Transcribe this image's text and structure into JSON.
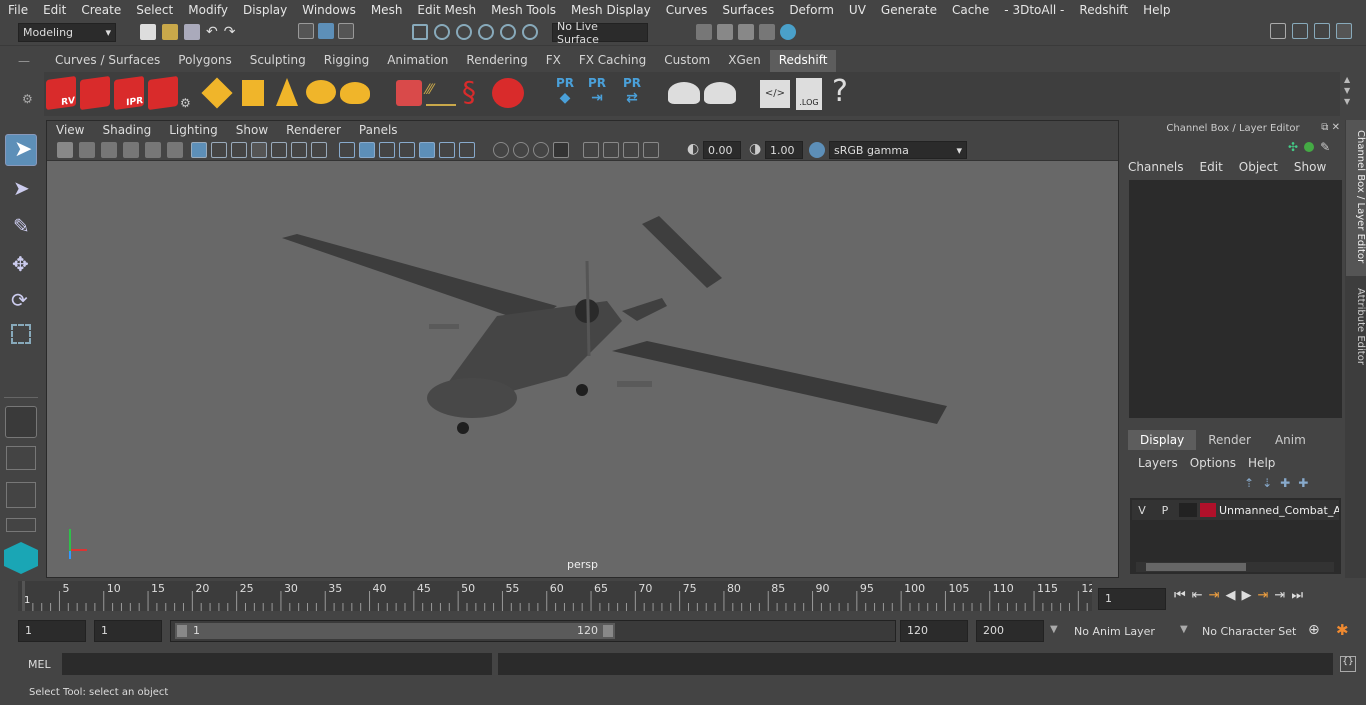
{
  "menu": [
    "File",
    "Edit",
    "Create",
    "Select",
    "Modify",
    "Display",
    "Windows",
    "Mesh",
    "Edit Mesh",
    "Mesh Tools",
    "Mesh Display",
    "Curves",
    "Surfaces",
    "Deform",
    "UV",
    "Generate",
    "Cache",
    "- 3DtoAll -",
    "Redshift",
    "Help"
  ],
  "status": {
    "workspace": "Modeling",
    "live_surface": "No Live Surface"
  },
  "shelf_tabs": [
    "Curves / Surfaces",
    "Polygons",
    "Sculpting",
    "Rigging",
    "Animation",
    "Rendering",
    "FX",
    "FX Caching",
    "Custom",
    "XGen",
    "Redshift"
  ],
  "shelf_active": "Redshift",
  "shelf_labels": {
    "rv": "RV",
    "ipr": "IPR",
    "pr": "PR",
    "log": ".LOG",
    "help": "?"
  },
  "viewport": {
    "menu": [
      "View",
      "Shading",
      "Lighting",
      "Show",
      "Renderer",
      "Panels"
    ],
    "exposure": "0.00",
    "gamma": "1.00",
    "colorspace": "sRGB gamma",
    "camera": "persp"
  },
  "channelbox": {
    "title": "Channel Box / Layer Editor",
    "menu": [
      "Channels",
      "Edit",
      "Object",
      "Show"
    ],
    "tabs": [
      "Display",
      "Render",
      "Anim"
    ],
    "layer_menu": [
      "Layers",
      "Options",
      "Help"
    ],
    "layer": {
      "v": "V",
      "p": "P",
      "name": "Unmanned_Combat_A",
      "color": "#b0102a"
    }
  },
  "side_tabs": [
    "Channel Box / Layer Editor",
    "Attribute Editor"
  ],
  "timeline": {
    "ticks": [
      "5",
      "10",
      "15",
      "20",
      "25",
      "30",
      "35",
      "40",
      "45",
      "50",
      "55",
      "60",
      "65",
      "70",
      "75",
      "80",
      "85",
      "90",
      "95",
      "100",
      "105",
      "110",
      "115",
      "12"
    ],
    "start_mark": "1",
    "current": "1"
  },
  "range": {
    "start": "1",
    "inner_start": "1",
    "slider_start": "1",
    "slider_end": "120",
    "end": "120",
    "max": "200",
    "anim_layer": "No Anim Layer",
    "char_set": "No Character Set"
  },
  "cmd": {
    "lang": "MEL"
  },
  "help_line": "Select Tool: select an object"
}
